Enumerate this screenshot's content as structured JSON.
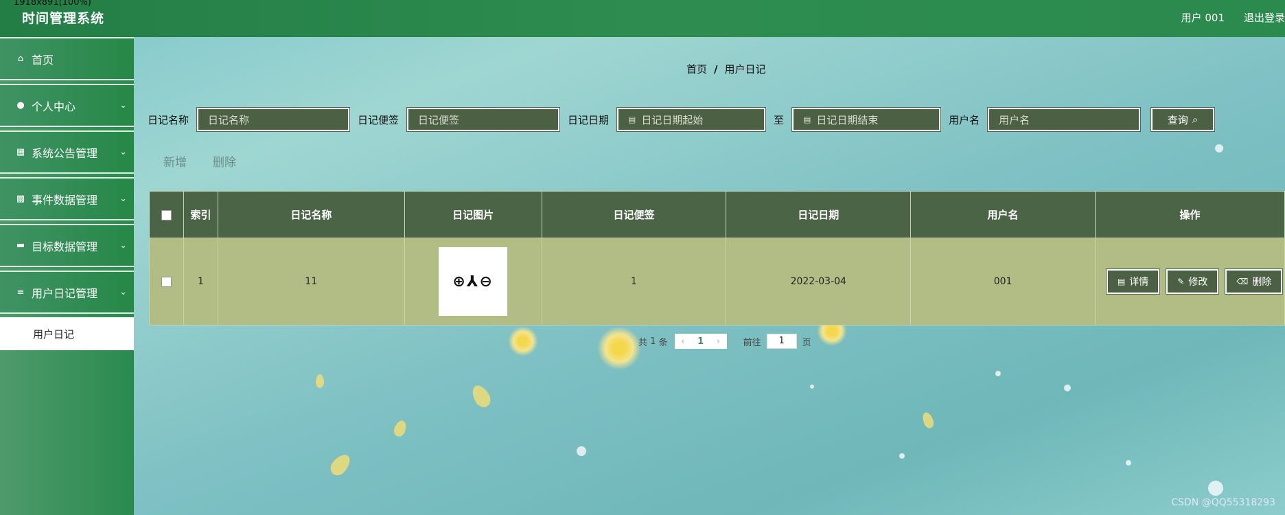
{
  "window": {
    "corner_text": "1918x891(100%)"
  },
  "topbar": {
    "title": "时间管理系统",
    "user_label": "用户 001",
    "logout_label": "退出登录"
  },
  "sidebar": {
    "items": [
      {
        "label": "首页",
        "icon": "home-icon"
      },
      {
        "label": "个人中心",
        "icon": "user-icon"
      },
      {
        "label": "系统公告管理",
        "icon": "grid-icon"
      },
      {
        "label": "事件数据管理",
        "icon": "apps-icon"
      },
      {
        "label": "目标数据管理",
        "icon": "monitor-icon"
      },
      {
        "label": "用户日记管理",
        "icon": "list-icon"
      }
    ],
    "sub_item": "用户日记"
  },
  "breadcrumb": {
    "home": "首页",
    "separator": "/",
    "current": "用户日记"
  },
  "search": {
    "name_label": "日记名称",
    "name_placeholder": "日记名称",
    "note_label": "日记便签",
    "note_placeholder": "日记便签",
    "date_label": "日记日期",
    "date_start_placeholder": "日记日期起始",
    "to_label": "至",
    "date_end_placeholder": "日记日期结束",
    "user_label": "用户名",
    "user_placeholder": "用户名",
    "query_label": "查询"
  },
  "actions": {
    "add": "新增",
    "delete": "删除"
  },
  "table": {
    "headers": [
      "索引",
      "日记名称",
      "日记图片",
      "日记便签",
      "日记日期",
      "用户名",
      "操作"
    ],
    "rows": [
      {
        "index": "1",
        "name": "11",
        "image_text": "⊕⅄⊖",
        "note": "1",
        "date": "2022-03-04",
        "user": "001"
      }
    ],
    "row_buttons": {
      "detail": "详情",
      "edit": "修改",
      "delete": "删除"
    }
  },
  "pagination": {
    "total_prefix": "共",
    "total": "1",
    "total_suffix": "条",
    "current_page": "1",
    "goto_label": "前往",
    "goto_value": "1",
    "page_suffix": "页"
  },
  "watermark": "CSDN @QQ55318293",
  "colors": {
    "topbar": "#2b8a4d",
    "header": "#4b6446",
    "row": "#b1bd84",
    "button": "#4c6144"
  }
}
